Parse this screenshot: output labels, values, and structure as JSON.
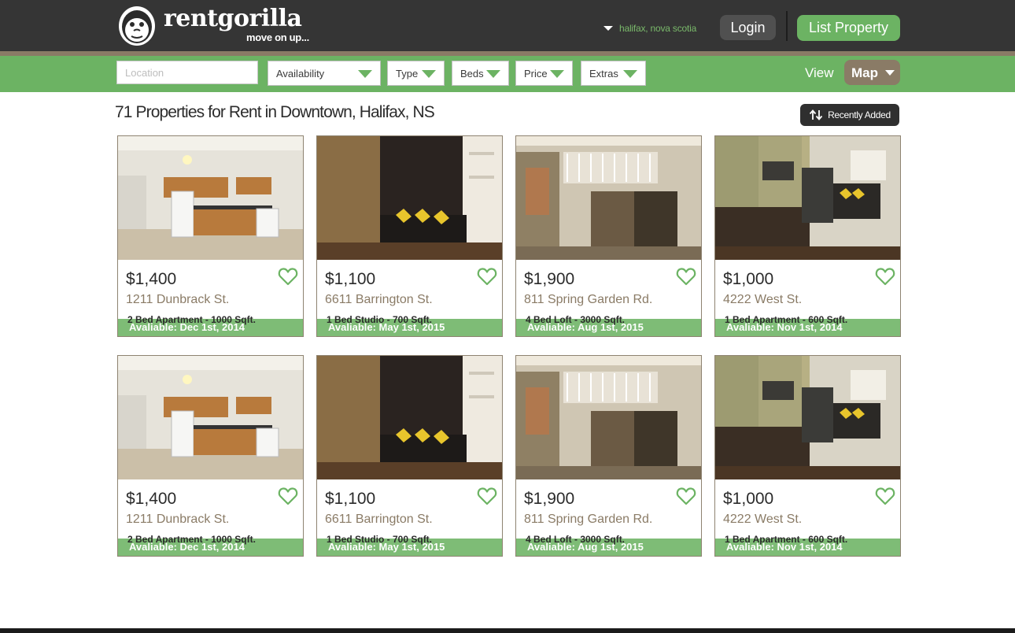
{
  "header": {
    "logo_name": "rentgorilla",
    "logo_tagline": "move on up...",
    "location": "halifax, nova scotia",
    "login_label": "Login",
    "list_property_label": "List Property"
  },
  "filters": {
    "location_placeholder": "Location",
    "availability_label": "Availability",
    "type_label": "Type",
    "beds_label": "Beds",
    "price_label": "Price",
    "extras_label": "Extras",
    "view_label": "View",
    "view_mode": "Map"
  },
  "results": {
    "title": "71 Properties for Rent in Downtown, Halifax, NS",
    "sort_label": "Recently Added"
  },
  "colors": {
    "header_bg": "#353535",
    "brand_green": "#6cb363",
    "accent_brown": "#8a7b66"
  },
  "listings": [
    {
      "available": "Avaliable: Dec 1st, 2014",
      "price": "$1,400",
      "address": "1211 Dunbrack St.",
      "details": "2 Bed Apartment - 1000 Sqft.",
      "photo": "kitchen"
    },
    {
      "available": "Avaliable: May 1st, 2015",
      "price": "$1,100",
      "address": "6611 Barrington St.",
      "details": "1 Bed Studio - 700 Sqft.",
      "photo": "studio"
    },
    {
      "available": "Avaliable: Aug 1st, 2015",
      "price": "$1,900",
      "address": "811 Spring Garden Rd.",
      "details": "4 Bed Loft - 3000 Sqft.",
      "photo": "loft"
    },
    {
      "available": "Avaliable: Nov 1st, 2014",
      "price": "$1,000",
      "address": "4222 West St.",
      "details": "1 Bed Apartment - 600 Sqft.",
      "photo": "apartment"
    },
    {
      "available": "Avaliable: Dec 1st, 2014",
      "price": "$1,400",
      "address": "1211 Dunbrack St.",
      "details": "2 Bed Apartment - 1000 Sqft.",
      "photo": "kitchen"
    },
    {
      "available": "Avaliable: May 1st, 2015",
      "price": "$1,100",
      "address": "6611 Barrington St.",
      "details": "1 Bed Studio - 700 Sqft.",
      "photo": "studio"
    },
    {
      "available": "Avaliable: Aug 1st, 2015",
      "price": "$1,900",
      "address": "811 Spring Garden Rd.",
      "details": "4 Bed Loft - 3000 Sqft.",
      "photo": "loft"
    },
    {
      "available": "Avaliable: Nov 1st, 2014",
      "price": "$1,000",
      "address": "4222 West St.",
      "details": "1 Bed Apartment - 600 Sqft.",
      "photo": "apartment"
    }
  ]
}
